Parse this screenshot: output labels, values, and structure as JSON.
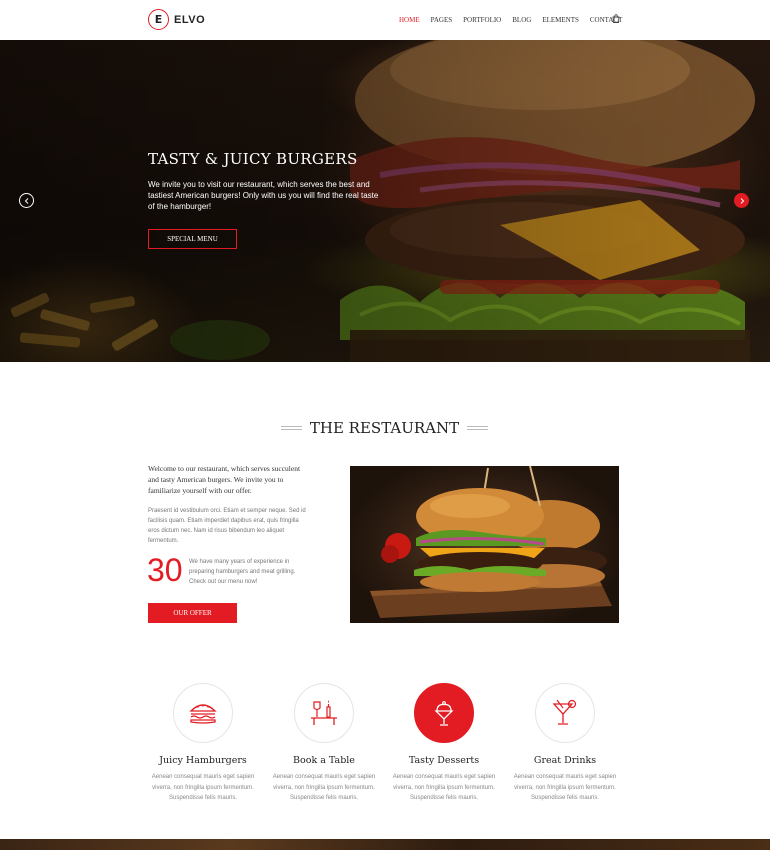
{
  "header": {
    "logo_letter": "E",
    "logo_text": "ELVO",
    "nav": [
      "HOME",
      "PAGES",
      "PORTFOLIO",
      "BLOG",
      "ELEMENTS",
      "CONTACT"
    ],
    "active_nav": "HOME"
  },
  "hero": {
    "title": "TASTY & JUICY BURGERS",
    "text": "We invite you to visit our restaurant, which serves the best and tastiest American burgers! Only with us you will find the real taste of the hamburger!",
    "button": "SPECIAL MENU"
  },
  "restaurant": {
    "title": "THE RESTAURANT",
    "intro": "Welcome to our restaurant, which serves succulent and tasty American burgers. We invite you to familiarize yourself with our offer.",
    "lorem": "Praesent id vestibulum orci. Etiam et semper neque. Sed id facilisis quam. Etiam imperdiet dapibus erat, quis fringilla eros dictum nec. Nam id risus bibendum leo aliquet fermentum.",
    "years": "30",
    "years_text": "We have many years of experience in preparing hamburgers and meat grilling. Check out our menu now!",
    "button": "OUR OFFER"
  },
  "features": [
    {
      "title": "Juicy Hamburgers",
      "text": "Aenean consequat mauris eget sapien viverra, non fringilla ipsum fermentum. Suspendisse felis mauris.",
      "icon": "hamburger-icon"
    },
    {
      "title": "Book a Table",
      "text": "Aenean consequat mauris eget sapien viverra, non fringilla ipsum fermentum. Suspendisse felis mauris.",
      "icon": "table-wine-icon"
    },
    {
      "title": "Tasty Desserts",
      "text": "Aenean consequat mauris eget sapien viverra, non fringilla ipsum fermentum. Suspendisse felis mauris.",
      "icon": "ice-cream-icon"
    },
    {
      "title": "Great Drinks",
      "text": "Aenean consequat mauris eget sapien viverra, non fringilla ipsum fermentum. Suspendisse felis mauris.",
      "icon": "cocktail-icon"
    }
  ],
  "colors": {
    "accent": "#e31c23",
    "text_dark": "#222222",
    "text_muted": "#888888"
  }
}
